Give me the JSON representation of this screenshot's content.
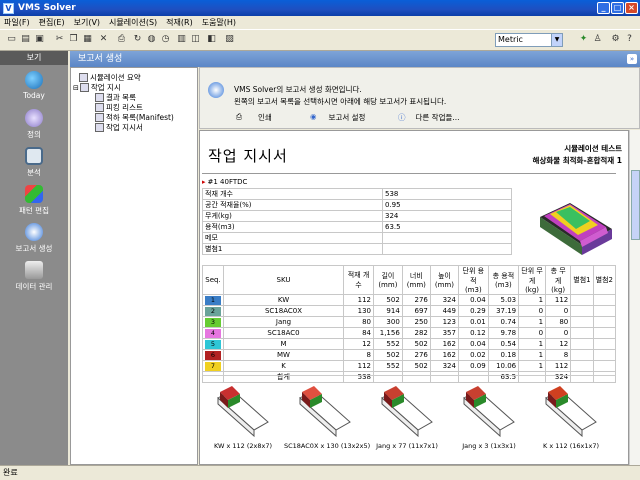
{
  "window": {
    "title": "VMS Solver",
    "buttons": [
      "_",
      "□",
      "×"
    ]
  },
  "menu": [
    "파일(F)",
    "편집(E)",
    "보기(V)",
    "시뮬레이션(S)",
    "적재(R)",
    "도움말(H)"
  ],
  "toolbar": {
    "units": "Metric"
  },
  "sidebar": {
    "header": "보기",
    "items": [
      "Today",
      "정의",
      "분석",
      "패턴 편집",
      "보고서 생성",
      "데이터 관리"
    ]
  },
  "main": {
    "header": "보고서 생성"
  },
  "tree": {
    "items": [
      "시뮬레이션 요약",
      "작업 지시",
      "결과 목록",
      "피킹 리스트",
      "적하 목록(Manifest)",
      "작업 지시서"
    ]
  },
  "info": {
    "line1": "VMS Solver의 보고서 생성 화면입니다.",
    "line2": "왼쪽의 보고서 목록을 선택하시면 아래에 해당 보고서가 표시됩니다.",
    "actions": [
      "인쇄",
      "보고서 설정",
      "다른 작업들..."
    ]
  },
  "report": {
    "title": "작업 지시서",
    "subtitle1": "시뮬레이션 테스트",
    "subtitle2": "해상화물 최적화-혼합적재 1",
    "container": "#1 40FTDC",
    "props": [
      {
        "k": "적재 개수",
        "v": "538"
      },
      {
        "k": "공간 적재율(%)",
        "v": "0.95"
      },
      {
        "k": "무게(kg)",
        "v": "324"
      },
      {
        "k": "용적(m3)",
        "v": "63.5"
      },
      {
        "k": "메모",
        "v": ""
      },
      {
        "k": "별첨1",
        "v": ""
      }
    ],
    "columns": [
      "Seq.",
      "SKU",
      "적재 개수",
      "길이 (mm)",
      "너비 (mm)",
      "높이 (mm)",
      "단위 용적 (m3)",
      "총 용적 (m3)",
      "단위 무게 (kg)",
      "총 무게 (kg)",
      "별첨1",
      "별첨2"
    ],
    "rows": [
      {
        "seq": "1",
        "sku": "KW",
        "qty": "112",
        "l": "502",
        "w": "276",
        "h": "324",
        "uv": "0.04",
        "tv": "5.03",
        "uw": "1",
        "tw": "112",
        "color": "#3a7dc6"
      },
      {
        "seq": "2",
        "sku": "SC18AC0X",
        "qty": "130",
        "l": "914",
        "w": "697",
        "h": "449",
        "uv": "0.29",
        "tv": "37.19",
        "uw": "0",
        "tw": "0",
        "color": "#6aa39a"
      },
      {
        "seq": "3",
        "sku": "Jang",
        "qty": "80",
        "l": "300",
        "w": "250",
        "h": "123",
        "uv": "0.01",
        "tv": "0.74",
        "uw": "1",
        "tw": "80",
        "color": "#66cc33"
      },
      {
        "seq": "4",
        "sku": "SC18AC0",
        "qty": "84",
        "l": "1,156",
        "w": "282",
        "h": "357",
        "uv": "0.12",
        "tv": "9.78",
        "uw": "0",
        "tw": "0",
        "color": "#e675e0"
      },
      {
        "seq": "5",
        "sku": "M",
        "qty": "12",
        "l": "552",
        "w": "502",
        "h": "162",
        "uv": "0.04",
        "tv": "0.54",
        "uw": "1",
        "tw": "12",
        "color": "#2ec6d6"
      },
      {
        "seq": "6",
        "sku": "MW",
        "qty": "8",
        "l": "502",
        "w": "276",
        "h": "162",
        "uv": "0.02",
        "tv": "0.18",
        "uw": "1",
        "tw": "8",
        "color": "#b22222"
      },
      {
        "seq": "7",
        "sku": "K",
        "qty": "112",
        "l": "552",
        "w": "502",
        "h": "324",
        "uv": "0.09",
        "tv": "10.06",
        "uw": "1",
        "tw": "112",
        "color": "#f0d020"
      }
    ],
    "total": {
      "label": "합계",
      "qty": "538",
      "tv": "63.5",
      "tw": "324"
    },
    "thumbs": [
      "KW x 112 (2x8x7)",
      "SC18AC0X x 130 (13x2x5)",
      "Jang x 77 (11x7x1)",
      "Jang x 3 (1x3x1)",
      "K x 112 (16x1x7)"
    ]
  },
  "status": "완료"
}
